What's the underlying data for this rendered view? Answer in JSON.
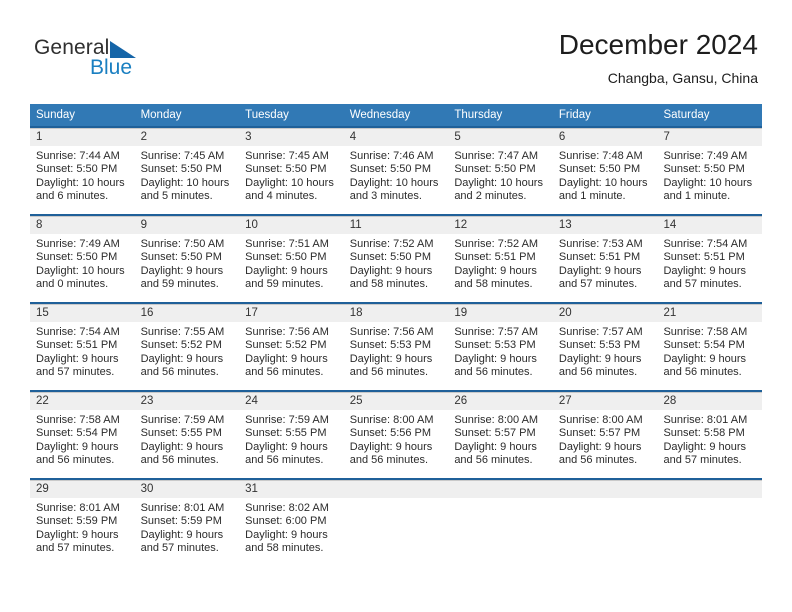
{
  "brand": {
    "word_one": "General",
    "word_two": "Blue",
    "flag_icon": "triangle-flag-icon",
    "brand_blue_hex": "#1a7fc1",
    "brand_dark_hex": "#2f2f2f"
  },
  "header": {
    "title": "December 2024",
    "subtitle": "Changba, Gansu, China"
  },
  "theme": {
    "header_band_hex": "#3179b5",
    "row_divider_hex": "#1f6099",
    "day_number_band_hex": "#efefef",
    "page_background_hex": "#ffffff"
  },
  "weekdays": [
    "Sunday",
    "Monday",
    "Tuesday",
    "Wednesday",
    "Thursday",
    "Friday",
    "Saturday"
  ],
  "weeks": [
    [
      {
        "day": "1",
        "sunrise": "Sunrise: 7:44 AM",
        "sunset": "Sunset: 5:50 PM",
        "daylight_line1": "Daylight: 10 hours",
        "daylight_line2": "and 6 minutes."
      },
      {
        "day": "2",
        "sunrise": "Sunrise: 7:45 AM",
        "sunset": "Sunset: 5:50 PM",
        "daylight_line1": "Daylight: 10 hours",
        "daylight_line2": "and 5 minutes."
      },
      {
        "day": "3",
        "sunrise": "Sunrise: 7:45 AM",
        "sunset": "Sunset: 5:50 PM",
        "daylight_line1": "Daylight: 10 hours",
        "daylight_line2": "and 4 minutes."
      },
      {
        "day": "4",
        "sunrise": "Sunrise: 7:46 AM",
        "sunset": "Sunset: 5:50 PM",
        "daylight_line1": "Daylight: 10 hours",
        "daylight_line2": "and 3 minutes."
      },
      {
        "day": "5",
        "sunrise": "Sunrise: 7:47 AM",
        "sunset": "Sunset: 5:50 PM",
        "daylight_line1": "Daylight: 10 hours",
        "daylight_line2": "and 2 minutes."
      },
      {
        "day": "6",
        "sunrise": "Sunrise: 7:48 AM",
        "sunset": "Sunset: 5:50 PM",
        "daylight_line1": "Daylight: 10 hours",
        "daylight_line2": "and 1 minute."
      },
      {
        "day": "7",
        "sunrise": "Sunrise: 7:49 AM",
        "sunset": "Sunset: 5:50 PM",
        "daylight_line1": "Daylight: 10 hours",
        "daylight_line2": "and 1 minute."
      }
    ],
    [
      {
        "day": "8",
        "sunrise": "Sunrise: 7:49 AM",
        "sunset": "Sunset: 5:50 PM",
        "daylight_line1": "Daylight: 10 hours",
        "daylight_line2": "and 0 minutes."
      },
      {
        "day": "9",
        "sunrise": "Sunrise: 7:50 AM",
        "sunset": "Sunset: 5:50 PM",
        "daylight_line1": "Daylight: 9 hours",
        "daylight_line2": "and 59 minutes."
      },
      {
        "day": "10",
        "sunrise": "Sunrise: 7:51 AM",
        "sunset": "Sunset: 5:50 PM",
        "daylight_line1": "Daylight: 9 hours",
        "daylight_line2": "and 59 minutes."
      },
      {
        "day": "11",
        "sunrise": "Sunrise: 7:52 AM",
        "sunset": "Sunset: 5:50 PM",
        "daylight_line1": "Daylight: 9 hours",
        "daylight_line2": "and 58 minutes."
      },
      {
        "day": "12",
        "sunrise": "Sunrise: 7:52 AM",
        "sunset": "Sunset: 5:51 PM",
        "daylight_line1": "Daylight: 9 hours",
        "daylight_line2": "and 58 minutes."
      },
      {
        "day": "13",
        "sunrise": "Sunrise: 7:53 AM",
        "sunset": "Sunset: 5:51 PM",
        "daylight_line1": "Daylight: 9 hours",
        "daylight_line2": "and 57 minutes."
      },
      {
        "day": "14",
        "sunrise": "Sunrise: 7:54 AM",
        "sunset": "Sunset: 5:51 PM",
        "daylight_line1": "Daylight: 9 hours",
        "daylight_line2": "and 57 minutes."
      }
    ],
    [
      {
        "day": "15",
        "sunrise": "Sunrise: 7:54 AM",
        "sunset": "Sunset: 5:51 PM",
        "daylight_line1": "Daylight: 9 hours",
        "daylight_line2": "and 57 minutes."
      },
      {
        "day": "16",
        "sunrise": "Sunrise: 7:55 AM",
        "sunset": "Sunset: 5:52 PM",
        "daylight_line1": "Daylight: 9 hours",
        "daylight_line2": "and 56 minutes."
      },
      {
        "day": "17",
        "sunrise": "Sunrise: 7:56 AM",
        "sunset": "Sunset: 5:52 PM",
        "daylight_line1": "Daylight: 9 hours",
        "daylight_line2": "and 56 minutes."
      },
      {
        "day": "18",
        "sunrise": "Sunrise: 7:56 AM",
        "sunset": "Sunset: 5:53 PM",
        "daylight_line1": "Daylight: 9 hours",
        "daylight_line2": "and 56 minutes."
      },
      {
        "day": "19",
        "sunrise": "Sunrise: 7:57 AM",
        "sunset": "Sunset: 5:53 PM",
        "daylight_line1": "Daylight: 9 hours",
        "daylight_line2": "and 56 minutes."
      },
      {
        "day": "20",
        "sunrise": "Sunrise: 7:57 AM",
        "sunset": "Sunset: 5:53 PM",
        "daylight_line1": "Daylight: 9 hours",
        "daylight_line2": "and 56 minutes."
      },
      {
        "day": "21",
        "sunrise": "Sunrise: 7:58 AM",
        "sunset": "Sunset: 5:54 PM",
        "daylight_line1": "Daylight: 9 hours",
        "daylight_line2": "and 56 minutes."
      }
    ],
    [
      {
        "day": "22",
        "sunrise": "Sunrise: 7:58 AM",
        "sunset": "Sunset: 5:54 PM",
        "daylight_line1": "Daylight: 9 hours",
        "daylight_line2": "and 56 minutes."
      },
      {
        "day": "23",
        "sunrise": "Sunrise: 7:59 AM",
        "sunset": "Sunset: 5:55 PM",
        "daylight_line1": "Daylight: 9 hours",
        "daylight_line2": "and 56 minutes."
      },
      {
        "day": "24",
        "sunrise": "Sunrise: 7:59 AM",
        "sunset": "Sunset: 5:55 PM",
        "daylight_line1": "Daylight: 9 hours",
        "daylight_line2": "and 56 minutes."
      },
      {
        "day": "25",
        "sunrise": "Sunrise: 8:00 AM",
        "sunset": "Sunset: 5:56 PM",
        "daylight_line1": "Daylight: 9 hours",
        "daylight_line2": "and 56 minutes."
      },
      {
        "day": "26",
        "sunrise": "Sunrise: 8:00 AM",
        "sunset": "Sunset: 5:57 PM",
        "daylight_line1": "Daylight: 9 hours",
        "daylight_line2": "and 56 minutes."
      },
      {
        "day": "27",
        "sunrise": "Sunrise: 8:00 AM",
        "sunset": "Sunset: 5:57 PM",
        "daylight_line1": "Daylight: 9 hours",
        "daylight_line2": "and 56 minutes."
      },
      {
        "day": "28",
        "sunrise": "Sunrise: 8:01 AM",
        "sunset": "Sunset: 5:58 PM",
        "daylight_line1": "Daylight: 9 hours",
        "daylight_line2": "and 57 minutes."
      }
    ],
    [
      {
        "day": "29",
        "sunrise": "Sunrise: 8:01 AM",
        "sunset": "Sunset: 5:59 PM",
        "daylight_line1": "Daylight: 9 hours",
        "daylight_line2": "and 57 minutes."
      },
      {
        "day": "30",
        "sunrise": "Sunrise: 8:01 AM",
        "sunset": "Sunset: 5:59 PM",
        "daylight_line1": "Daylight: 9 hours",
        "daylight_line2": "and 57 minutes."
      },
      {
        "day": "31",
        "sunrise": "Sunrise: 8:02 AM",
        "sunset": "Sunset: 6:00 PM",
        "daylight_line1": "Daylight: 9 hours",
        "daylight_line2": "and 58 minutes."
      },
      {
        "day": "",
        "sunrise": "",
        "sunset": "",
        "daylight_line1": "",
        "daylight_line2": ""
      },
      {
        "day": "",
        "sunrise": "",
        "sunset": "",
        "daylight_line1": "",
        "daylight_line2": ""
      },
      {
        "day": "",
        "sunrise": "",
        "sunset": "",
        "daylight_line1": "",
        "daylight_line2": ""
      },
      {
        "day": "",
        "sunrise": "",
        "sunset": "",
        "daylight_line1": "",
        "daylight_line2": ""
      }
    ]
  ]
}
